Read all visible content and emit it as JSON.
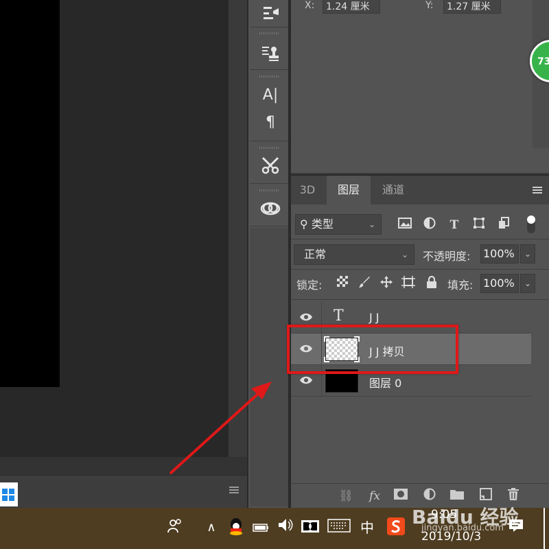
{
  "properties": {
    "x_label": "X:",
    "x_value": "1.24 厘米",
    "y_label": "Y:",
    "y_value": "1.27 厘米"
  },
  "floating_badge": "73",
  "dock": {
    "icons": [
      "adjustments-icon",
      "clone-source-icon",
      "character-icon",
      "paragraph-icon",
      "tool-presets-icon",
      "creative-cloud-icon"
    ],
    "char_glyph": "A|",
    "para_glyph": "¶"
  },
  "layers_panel": {
    "tabs": [
      {
        "label": "3D",
        "active": false
      },
      {
        "label": "图层",
        "active": true
      },
      {
        "label": "通道",
        "active": false
      }
    ],
    "filter": {
      "label": "类型"
    },
    "blend_mode": "正常",
    "opacity_label": "不透明度:",
    "opacity_value": "100%",
    "lock_label": "锁定:",
    "fill_label": "填充:",
    "fill_value": "100%",
    "layers": [
      {
        "name": "J J",
        "kind": "text",
        "visible": true,
        "selected": false
      },
      {
        "name": "J J 拷贝",
        "kind": "raster",
        "visible": true,
        "selected": true
      },
      {
        "name": "图层 0",
        "kind": "raster-black",
        "visible": true,
        "selected": false
      }
    ],
    "footer_icons": [
      "link-icon",
      "fx-icon",
      "mask-icon",
      "adjustment-layer-icon",
      "group-icon",
      "new-layer-icon",
      "trash-icon"
    ],
    "fx_label": "fx"
  },
  "annotation": {
    "color": "#e01818"
  },
  "taskbar": {
    "ime_label": "中",
    "time": "9:05",
    "date": "2019/10/3",
    "watermark": "Baidu 经验",
    "watermark_sub": "jingyan.baidu.com"
  },
  "colors": {
    "panel": "#535353",
    "workspace": "#282828",
    "taskbar": "#4e3d21",
    "selected_layer": "#6c6c6c"
  }
}
